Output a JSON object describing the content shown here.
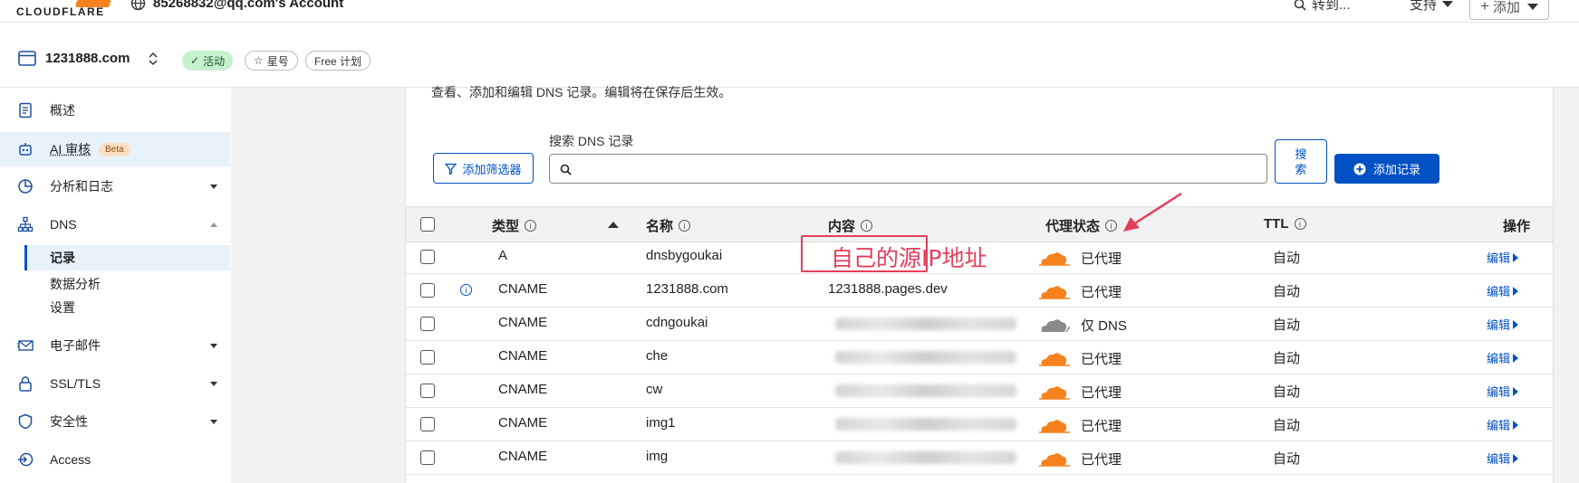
{
  "brand": {
    "logo_text": "CLOUDFLARE"
  },
  "account": {
    "name": "85268832@qq.com's Account"
  },
  "topnav": {
    "goto": "转到...",
    "support": "支持",
    "add": "添加"
  },
  "zone": {
    "name": "1231888.com",
    "status": "活动",
    "star": "星号",
    "plan": "Free 计划"
  },
  "sidebar": {
    "items": [
      {
        "label": "概述"
      },
      {
        "label": "AI 审核",
        "badge": "Beta"
      },
      {
        "label": "分析和日志"
      },
      {
        "label": "DNS"
      },
      {
        "label": "电子邮件"
      },
      {
        "label": "SSL/TLS"
      },
      {
        "label": "安全性"
      },
      {
        "label": "Access"
      }
    ],
    "dns_sub": [
      "记录",
      "数据分析",
      "设置"
    ]
  },
  "main": {
    "description": "查看、添加和编辑 DNS 记录。编辑将在保存后生效。",
    "search_label": "搜索 DNS 记录",
    "filter_button": "添加筛选器",
    "search_button": "搜索",
    "add_record_button": "添加记录"
  },
  "table": {
    "headers": {
      "type": "类型",
      "name": "名称",
      "content": "内容",
      "proxy": "代理状态",
      "ttl": "TTL",
      "action": "操作"
    },
    "rows": [
      {
        "type": "A",
        "name": "dnsbygoukai",
        "content": "",
        "proxy": "已代理",
        "ttl": "自动",
        "edit": "编辑"
      },
      {
        "type": "CNAME",
        "name": "1231888.com",
        "content": "1231888.pages.dev",
        "proxy": "已代理",
        "ttl": "自动",
        "edit": "编辑"
      },
      {
        "type": "CNAME",
        "name": "cdngoukai",
        "content": "",
        "proxy": "仅 DNS",
        "ttl": "自动",
        "edit": "编辑"
      },
      {
        "type": "CNAME",
        "name": "che",
        "content": "",
        "proxy": "已代理",
        "ttl": "自动",
        "edit": "编辑"
      },
      {
        "type": "CNAME",
        "name": "cw",
        "content": "",
        "proxy": "已代理",
        "ttl": "自动",
        "edit": "编辑"
      },
      {
        "type": "CNAME",
        "name": "img1",
        "content": "",
        "proxy": "已代理",
        "ttl": "自动",
        "edit": "编辑"
      },
      {
        "type": "CNAME",
        "name": "img",
        "content": "",
        "proxy": "已代理",
        "ttl": "自动",
        "edit": "编辑"
      }
    ]
  },
  "annotation": {
    "text": "自己的源IP地址"
  },
  "colors": {
    "accent": "#0051c3",
    "proxied_cloud": "#f6821f",
    "dns_only_cloud": "#8a8a8a",
    "annotation": "#e53e5b",
    "active_chip": "#c7f0cf"
  }
}
